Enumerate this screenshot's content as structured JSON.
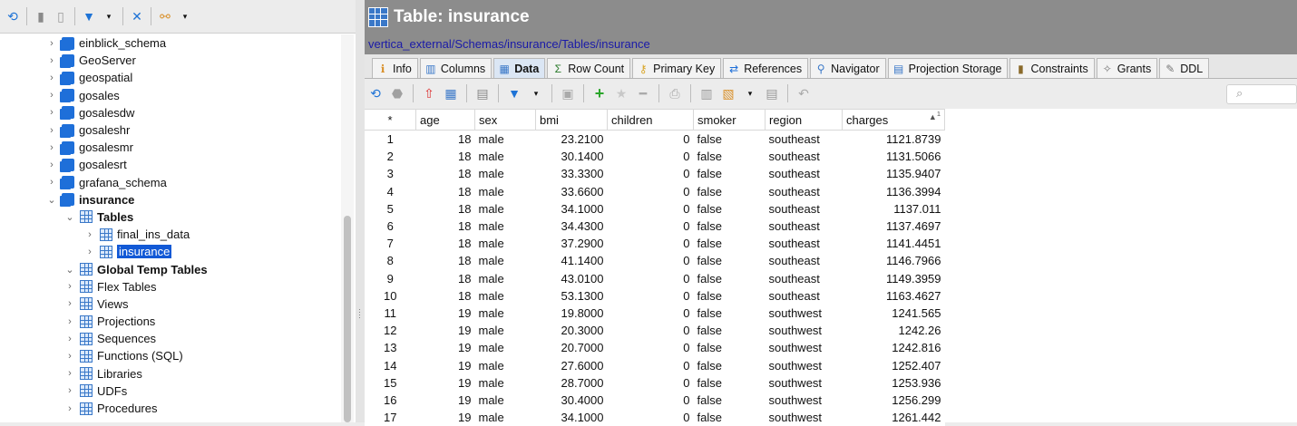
{
  "left_toolbar": {
    "icons": [
      "refresh-icon",
      "db-icon",
      "db-add-icon",
      "filter-icon",
      "dropdown-icon",
      "collapse-icon",
      "link-icon",
      "dropdown-icon"
    ]
  },
  "tree": [
    {
      "label": "einblick_schema",
      "level": 1,
      "type": "schema",
      "expanded": false
    },
    {
      "label": "GeoServer",
      "level": 1,
      "type": "schema",
      "expanded": false
    },
    {
      "label": "geospatial",
      "level": 1,
      "type": "schema",
      "expanded": false
    },
    {
      "label": "gosales",
      "level": 1,
      "type": "schema",
      "expanded": false
    },
    {
      "label": "gosalesdw",
      "level": 1,
      "type": "schema",
      "expanded": false
    },
    {
      "label": "gosaleshr",
      "level": 1,
      "type": "schema",
      "expanded": false
    },
    {
      "label": "gosalesmr",
      "level": 1,
      "type": "schema",
      "expanded": false
    },
    {
      "label": "gosalesrt",
      "level": 1,
      "type": "schema",
      "expanded": false
    },
    {
      "label": "grafana_schema",
      "level": 1,
      "type": "schema",
      "expanded": false
    },
    {
      "label": "insurance",
      "level": 1,
      "type": "schema",
      "expanded": true,
      "bold": true
    },
    {
      "label": "Tables",
      "level": 2,
      "type": "folder",
      "expanded": true,
      "bold": true
    },
    {
      "label": "final_ins_data",
      "level": 3,
      "type": "table",
      "expanded": false
    },
    {
      "label": "insurance",
      "level": 3,
      "type": "table",
      "expanded": false,
      "selected": true
    },
    {
      "label": "Global Temp Tables",
      "level": 2,
      "type": "folder",
      "expanded": true,
      "bold": true
    },
    {
      "label": "Flex Tables",
      "level": 2,
      "type": "folder",
      "expanded": false
    },
    {
      "label": "Views",
      "level": 2,
      "type": "folder",
      "expanded": false
    },
    {
      "label": "Projections",
      "level": 2,
      "type": "folder",
      "expanded": false
    },
    {
      "label": "Sequences",
      "level": 2,
      "type": "folder",
      "expanded": false
    },
    {
      "label": "Functions (SQL)",
      "level": 2,
      "type": "folder",
      "expanded": false
    },
    {
      "label": "Libraries",
      "level": 2,
      "type": "folder",
      "expanded": false
    },
    {
      "label": "UDFs",
      "level": 2,
      "type": "folder",
      "expanded": false
    },
    {
      "label": "Procedures",
      "level": 2,
      "type": "folder",
      "expanded": false
    }
  ],
  "editor": {
    "title": "Table: insurance",
    "path": "vertica_external/Schemas/insurance/Tables/insurance"
  },
  "tabs": [
    {
      "label": "Info",
      "icon": "info-icon",
      "active": false
    },
    {
      "label": "Columns",
      "icon": "columns-icon",
      "active": false
    },
    {
      "label": "Data",
      "icon": "data-icon",
      "active": true
    },
    {
      "label": "Row Count",
      "icon": "sum-icon",
      "active": false
    },
    {
      "label": "Primary Key",
      "icon": "key-icon",
      "active": false
    },
    {
      "label": "References",
      "icon": "references-icon",
      "active": false
    },
    {
      "label": "Navigator",
      "icon": "navigator-icon",
      "active": false
    },
    {
      "label": "Projection Storage",
      "icon": "storage-icon",
      "active": false
    },
    {
      "label": "Constraints",
      "icon": "constraints-icon",
      "active": false
    },
    {
      "label": "Grants",
      "icon": "grants-icon",
      "active": false
    },
    {
      "label": "DDL",
      "icon": "ddl-icon",
      "active": false
    }
  ],
  "data_toolbar": {
    "icons": [
      "refresh-icon",
      "stop-icon",
      "export-icon",
      "grid-icon",
      "form-icon",
      "filter-icon",
      "dropdown-icon",
      "save-icon",
      "add-row-icon",
      "star-icon",
      "delete-row-icon",
      "print-icon",
      "copy-icon",
      "import-icon",
      "dropdown-icon",
      "sql-icon",
      "undo-icon"
    ],
    "search_placeholder": ""
  },
  "table": {
    "rownum_header": "*",
    "columns": [
      "age",
      "sex",
      "bmi",
      "children",
      "smoker",
      "region",
      "charges"
    ],
    "sort_indicator": "1",
    "rows": [
      [
        "1",
        "18",
        "male",
        "23.2100",
        "0",
        "false",
        "southeast",
        "1121.8739"
      ],
      [
        "2",
        "18",
        "male",
        "30.1400",
        "0",
        "false",
        "southeast",
        "1131.5066"
      ],
      [
        "3",
        "18",
        "male",
        "33.3300",
        "0",
        "false",
        "southeast",
        "1135.9407"
      ],
      [
        "4",
        "18",
        "male",
        "33.6600",
        "0",
        "false",
        "southeast",
        "1136.3994"
      ],
      [
        "5",
        "18",
        "male",
        "34.1000",
        "0",
        "false",
        "southeast",
        "1137.011"
      ],
      [
        "6",
        "18",
        "male",
        "34.4300",
        "0",
        "false",
        "southeast",
        "1137.4697"
      ],
      [
        "7",
        "18",
        "male",
        "37.2900",
        "0",
        "false",
        "southeast",
        "1141.4451"
      ],
      [
        "8",
        "18",
        "male",
        "41.1400",
        "0",
        "false",
        "southeast",
        "1146.7966"
      ],
      [
        "9",
        "18",
        "male",
        "43.0100",
        "0",
        "false",
        "southeast",
        "1149.3959"
      ],
      [
        "10",
        "18",
        "male",
        "53.1300",
        "0",
        "false",
        "southeast",
        "1163.4627"
      ],
      [
        "11",
        "19",
        "male",
        "19.8000",
        "0",
        "false",
        "southwest",
        "1241.565"
      ],
      [
        "12",
        "19",
        "male",
        "20.3000",
        "0",
        "false",
        "southwest",
        "1242.26"
      ],
      [
        "13",
        "19",
        "male",
        "20.7000",
        "0",
        "false",
        "southwest",
        "1242.816"
      ],
      [
        "14",
        "19",
        "male",
        "27.6000",
        "0",
        "false",
        "southwest",
        "1252.407"
      ],
      [
        "15",
        "19",
        "male",
        "28.7000",
        "0",
        "false",
        "southwest",
        "1253.936"
      ],
      [
        "16",
        "19",
        "male",
        "30.4000",
        "0",
        "false",
        "southwest",
        "1256.299"
      ],
      [
        "17",
        "19",
        "male",
        "34.1000",
        "0",
        "false",
        "southwest",
        "1261.442"
      ]
    ]
  }
}
